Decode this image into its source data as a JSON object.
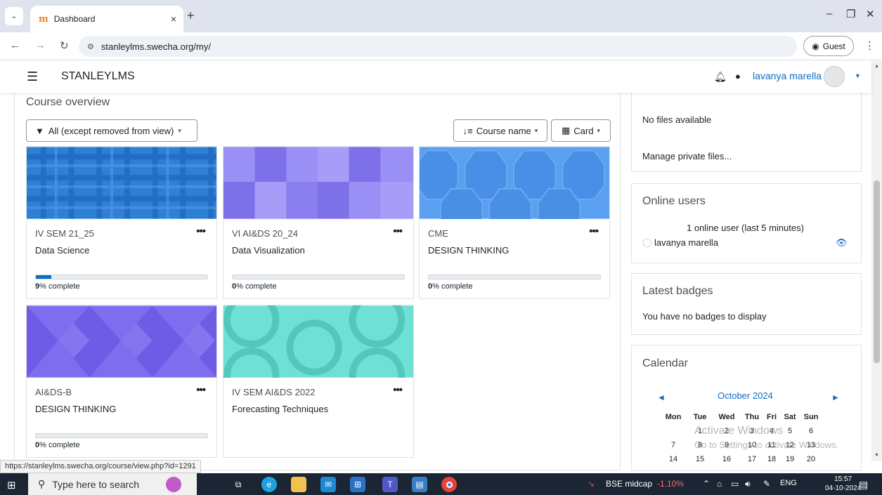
{
  "browser": {
    "tab_title": "Dashboard",
    "tab_close": "×",
    "new_tab": "+",
    "url": "stanleylms.swecha.org/my/",
    "profile_label": "Guest",
    "status_url": "https://stanleylms.swecha.org/course/view.php?id=1291"
  },
  "navbar": {
    "brand": "STANLEYLMS",
    "user_name": "lavanya marella"
  },
  "course_overview": {
    "title": "Course overview",
    "filter_label": "All (except removed from view)",
    "sort_label": "Course name",
    "view_label": "Card",
    "courses": [
      {
        "category": "IV SEM 21_25",
        "name": "Data Science",
        "progress": 9,
        "progress_label": "% complete",
        "pct_text": "9"
      },
      {
        "category": "VI AI&DS 20_24",
        "name": "Data Visualization",
        "progress": 0,
        "progress_label": "% complete",
        "pct_text": "0"
      },
      {
        "category": "CME",
        "name": "DESIGN THINKING",
        "progress": 0,
        "progress_label": "% complete",
        "pct_text": "0"
      },
      {
        "category": "AI&DS-B",
        "name": "DESIGN THINKING",
        "progress": 0,
        "progress_label": "% complete",
        "pct_text": "0"
      },
      {
        "category": "IV SEM AI&DS 2022",
        "name": "Forecasting Techniques",
        "progress": null,
        "progress_label": "",
        "pct_text": ""
      }
    ]
  },
  "private_files": {
    "empty_text": "No files available",
    "manage_link": "Manage private files..."
  },
  "online_users": {
    "title": "Online users",
    "summary": "1 online user (last 5 minutes)",
    "user": "lavanya marella"
  },
  "latest_badges": {
    "title": "Latest badges",
    "empty_text": "You have no badges to display"
  },
  "calendar": {
    "title": "Calendar",
    "month": "October 2024",
    "prev": "◄",
    "next": "►",
    "weekdays": [
      "Mon",
      "Tue",
      "Wed",
      "Thu",
      "Fri",
      "Sat",
      "Sun"
    ],
    "rows": [
      [
        "",
        "1",
        "2",
        "3",
        "4",
        "5",
        "6"
      ],
      [
        "7",
        "8",
        "9",
        "10",
        "11",
        "12",
        "13"
      ],
      [
        "14",
        "15",
        "16",
        "17",
        "18",
        "19",
        "20"
      ]
    ]
  },
  "watermark": {
    "line1": "Activate Windows",
    "line2": "Go to Settings to activate Windows."
  },
  "taskbar": {
    "search_placeholder": "Type here to search",
    "stock_name": "BSE midcap",
    "stock_change": "-1.10%",
    "lang": "ENG",
    "time": "15:57",
    "date": "04-10-2024"
  }
}
